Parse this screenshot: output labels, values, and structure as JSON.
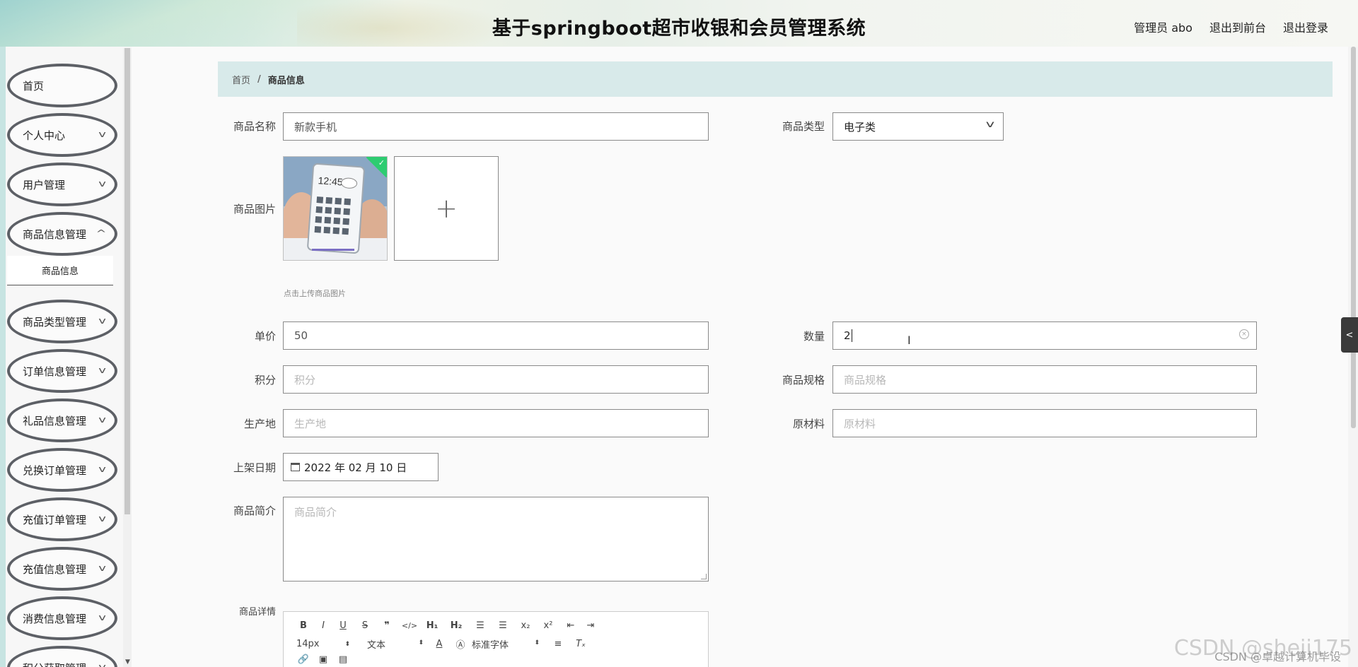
{
  "header": {
    "title": "基于springboot超市收银和会员管理系统",
    "user_label": "管理员 abo",
    "front_label": "退出到前台",
    "logout_label": "退出登录"
  },
  "sidebar": {
    "items": [
      {
        "label": "首页",
        "has_children": false
      },
      {
        "label": "个人中心",
        "has_children": true
      },
      {
        "label": "用户管理",
        "has_children": true
      },
      {
        "label": "商品信息管理",
        "has_children": true
      },
      {
        "label": "商品类型管理",
        "has_children": true
      },
      {
        "label": "订单信息管理",
        "has_children": true
      },
      {
        "label": "礼品信息管理",
        "has_children": true
      },
      {
        "label": "兑换订单管理",
        "has_children": true
      },
      {
        "label": "充值订单管理",
        "has_children": true
      },
      {
        "label": "充值信息管理",
        "has_children": true
      },
      {
        "label": "消费信息管理",
        "has_children": true
      },
      {
        "label": "积分获取管理",
        "has_children": true
      }
    ],
    "submenu": {
      "label": "商品信息"
    }
  },
  "breadcrumb": {
    "home": "首页",
    "separator": "/",
    "current": "商品信息"
  },
  "form": {
    "name": {
      "label": "商品名称",
      "value": "新款手机"
    },
    "type": {
      "label": "商品类型",
      "value": "电子类"
    },
    "image": {
      "label": "商品图片",
      "tip": "点击上传商品图片"
    },
    "price": {
      "label": "单价",
      "value": "50"
    },
    "quantity": {
      "label": "数量",
      "value": "2"
    },
    "points": {
      "label": "积分",
      "placeholder": "积分"
    },
    "spec": {
      "label": "商品规格",
      "placeholder": "商品规格"
    },
    "origin": {
      "label": "生产地",
      "placeholder": "生产地"
    },
    "material": {
      "label": "原材料",
      "placeholder": "原材料"
    },
    "date": {
      "label": "上架日期",
      "value": "2022 年 02 月 10 日"
    },
    "intro": {
      "label": "商品简介",
      "placeholder": "商品简介"
    },
    "detail": {
      "label": "商品详情",
      "toolbar": {
        "font_size": "14px",
        "text_type": "文本",
        "font_family": "标准字体"
      }
    }
  },
  "watermark": {
    "main": "CSDN @sheji175",
    "sub": "CSDN @卓越计算机毕设"
  },
  "colors": {
    "accent_green": "#2ecc71",
    "breadcrumb_bg": "#d8eaea",
    "menu_border": "#5d6066"
  }
}
